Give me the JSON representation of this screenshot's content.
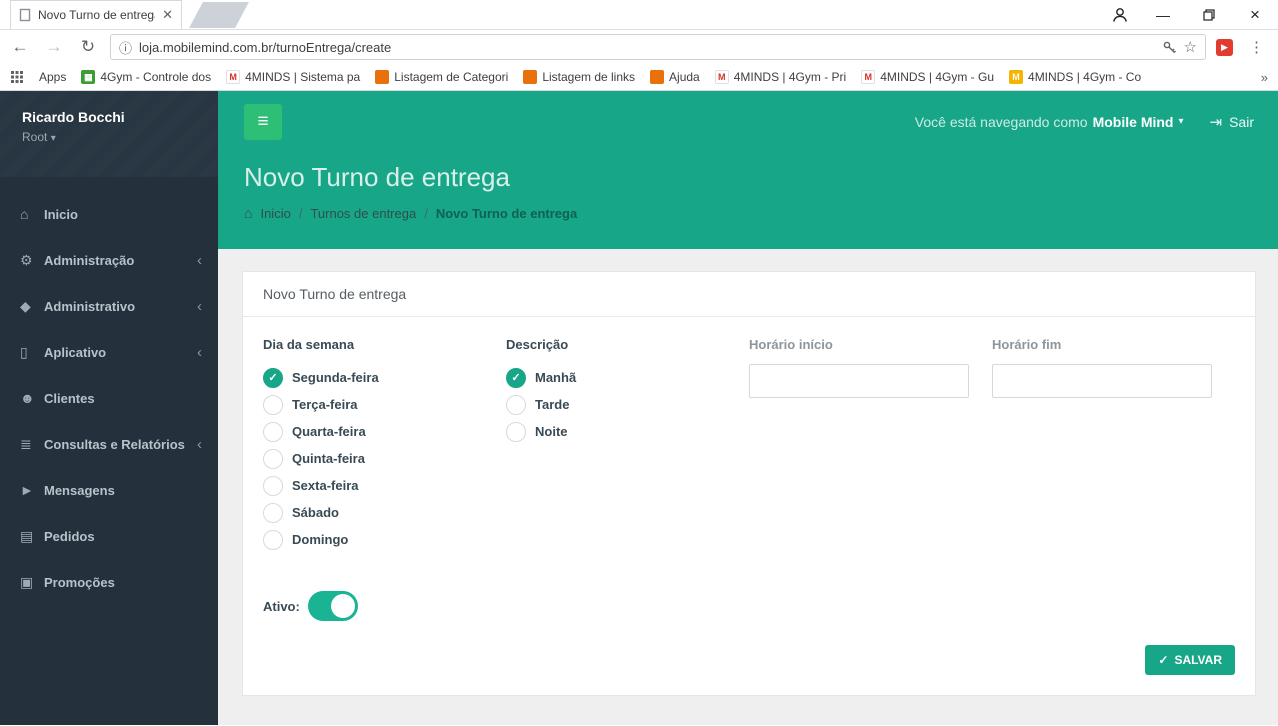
{
  "browser": {
    "tab_title": "Novo Turno de entrega",
    "url": "loja.mobilemind.com.br/turnoEntrega/create",
    "bookmarks_bar": {
      "apps_label": "Apps",
      "items": [
        {
          "label": "4Gym - Controle dos",
          "icon": "table-icon",
          "color": "#3e9c35",
          "glyph": "▦"
        },
        {
          "label": "4MINDS | Sistema pa",
          "icon": "gmail-m-icon",
          "color": "#ffffff",
          "glyph": "M"
        },
        {
          "label": "Listagem de Categori",
          "icon": "site-icon",
          "color": "#e8710a",
          "glyph": ""
        },
        {
          "label": "Listagem de links",
          "icon": "site-icon",
          "color": "#e8710a",
          "glyph": ""
        },
        {
          "label": "Ajuda",
          "icon": "site-icon",
          "color": "#e8710a",
          "glyph": ""
        },
        {
          "label": "4MINDS | 4Gym - Pri",
          "icon": "gmail-m-icon",
          "color": "#ffffff",
          "glyph": "M"
        },
        {
          "label": "4MINDS | 4Gym - Gu",
          "icon": "gmail-m-icon",
          "color": "#ffffff",
          "glyph": "M"
        },
        {
          "label": "4MINDS | 4Gym - Co",
          "icon": "m-icon",
          "color": "#f4b400",
          "glyph": "M"
        }
      ]
    }
  },
  "sidebar": {
    "user_name": "Ricardo Bocchi",
    "user_role": "Root",
    "items": [
      {
        "label": "Inicio",
        "icon": "home-icon",
        "expandable": false
      },
      {
        "label": "Administração",
        "icon": "gears-icon",
        "expandable": true
      },
      {
        "label": "Administrativo",
        "icon": "tag-icon",
        "expandable": true
      },
      {
        "label": "Aplicativo",
        "icon": "mobile-icon",
        "expandable": true
      },
      {
        "label": "Clientes",
        "icon": "users-icon",
        "expandable": false
      },
      {
        "label": "Consultas e Relatórios",
        "icon": "list-icon",
        "expandable": true
      },
      {
        "label": "Mensagens",
        "icon": "megaphone-icon",
        "expandable": false
      },
      {
        "label": "Pedidos",
        "icon": "document-icon",
        "expandable": false
      },
      {
        "label": "Promoções",
        "icon": "gift-icon",
        "expandable": false
      }
    ]
  },
  "topbar": {
    "navigating_as_text": "Você está navegando como",
    "navigating_as_user": "Mobile Mind",
    "logout_label": "Sair"
  },
  "page": {
    "title": "Novo Turno de entrega",
    "breadcrumb": [
      {
        "label": "Inicio",
        "active": false
      },
      {
        "label": "Turnos de entrega",
        "active": false
      },
      {
        "label": "Novo Turno de entrega",
        "active": true
      }
    ]
  },
  "form": {
    "card_title": "Novo Turno de entrega",
    "day_of_week": {
      "label": "Dia da semana",
      "options": [
        {
          "label": "Segunda-feira",
          "checked": true
        },
        {
          "label": "Terça-feira",
          "checked": false
        },
        {
          "label": "Quarta-feira",
          "checked": false
        },
        {
          "label": "Quinta-feira",
          "checked": false
        },
        {
          "label": "Sexta-feira",
          "checked": false
        },
        {
          "label": "Sábado",
          "checked": false
        },
        {
          "label": "Domingo",
          "checked": false
        }
      ]
    },
    "description": {
      "label": "Descrição",
      "options": [
        {
          "label": "Manhã",
          "checked": true
        },
        {
          "label": "Tarde",
          "checked": false
        },
        {
          "label": "Noite",
          "checked": false
        }
      ]
    },
    "start_time": {
      "label": "Horário início",
      "value": ""
    },
    "end_time": {
      "label": "Horário fim",
      "value": ""
    },
    "active": {
      "label": "Ativo:",
      "value": true
    },
    "save_label": "SALVAR"
  },
  "colors": {
    "accent_teal": "#18a689",
    "hamburger_green": "#2ebf77",
    "sidebar_bg": "#24303c",
    "content_bg": "#efefef"
  }
}
